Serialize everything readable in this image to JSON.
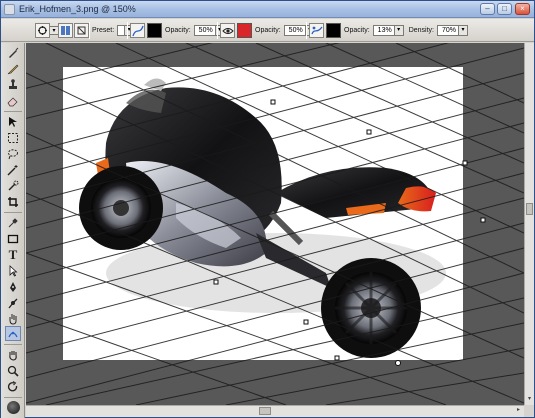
{
  "window": {
    "title": "Erik_Hofmen_3.png @ 150%"
  },
  "toolbar": {
    "preset_label": "Preset:",
    "opacity_label": "Opacity:",
    "density_label": "Density:",
    "opacity_1": "50%",
    "opacity_2": "50%",
    "opacity_3": "13%",
    "density": "70%",
    "color_1": "#000000",
    "color_2": "#d8262a",
    "color_3": "#000000"
  },
  "tools": [
    "brush-icon",
    "pencil-icon",
    "stamp-icon",
    "eraser-icon",
    "move-icon",
    "marquee-icon",
    "lasso-icon",
    "wand-icon",
    "paint-select-icon",
    "crop-icon",
    "eyedropper-icon",
    "rectangle-icon",
    "text-icon",
    "path-select-icon",
    "pen-icon",
    "gradient-icon",
    "smudge-icon",
    "perspective-icon",
    "hand-icon",
    "zoom-icon",
    "rotate-icon",
    "color-icon",
    "quickmask-icon",
    "screen-mode-icon"
  ],
  "colors": {
    "canvas_bg": "#585858",
    "paper": "#ffffff",
    "grid_lines": "#1a1a1a",
    "accent_orange": "#e86a1a",
    "accent_red": "#d81e1e"
  }
}
